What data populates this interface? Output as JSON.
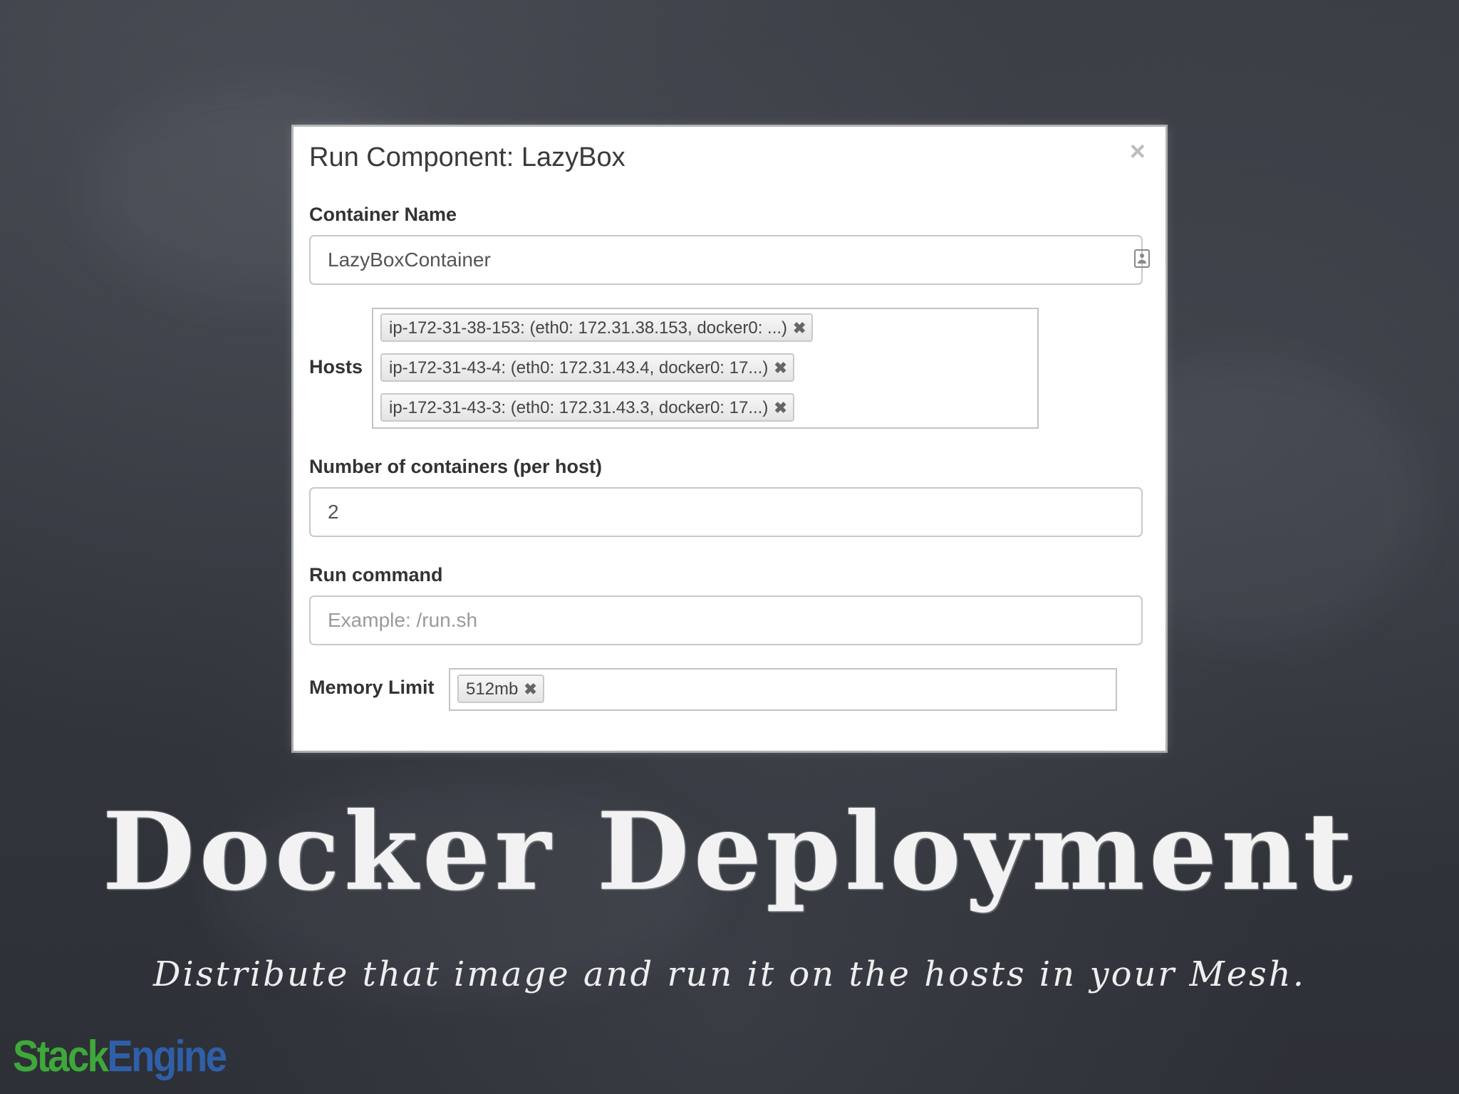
{
  "dialog": {
    "title": "Run Component: LazyBox",
    "close_glyph": "×",
    "container_name": {
      "label": "Container Name",
      "value": "LazyBoxContainer"
    },
    "hosts": {
      "label": "Hosts",
      "tags": [
        "ip-172-31-38-153: (eth0: 172.31.38.153, docker0: ...)",
        "ip-172-31-43-4: (eth0: 172.31.43.4, docker0: 17...)",
        "ip-172-31-43-3: (eth0: 172.31.43.3, docker0: 17...)"
      ]
    },
    "containers_per_host": {
      "label": "Number of containers (per host)",
      "value": "2"
    },
    "run_command": {
      "label": "Run command",
      "placeholder": "Example: /run.sh"
    },
    "memory_limit": {
      "label": "Memory Limit",
      "tags": [
        "512mb"
      ]
    },
    "remove_glyph": "✖"
  },
  "slide": {
    "title": "Docker Deployment",
    "subtitle": "Distribute that image and run it on the hosts in your Mesh."
  },
  "logo": {
    "part1": "Stack",
    "part2": "Engine",
    "colors": {
      "stack": "#3ea83a",
      "engine": "#2f5fa8"
    }
  }
}
